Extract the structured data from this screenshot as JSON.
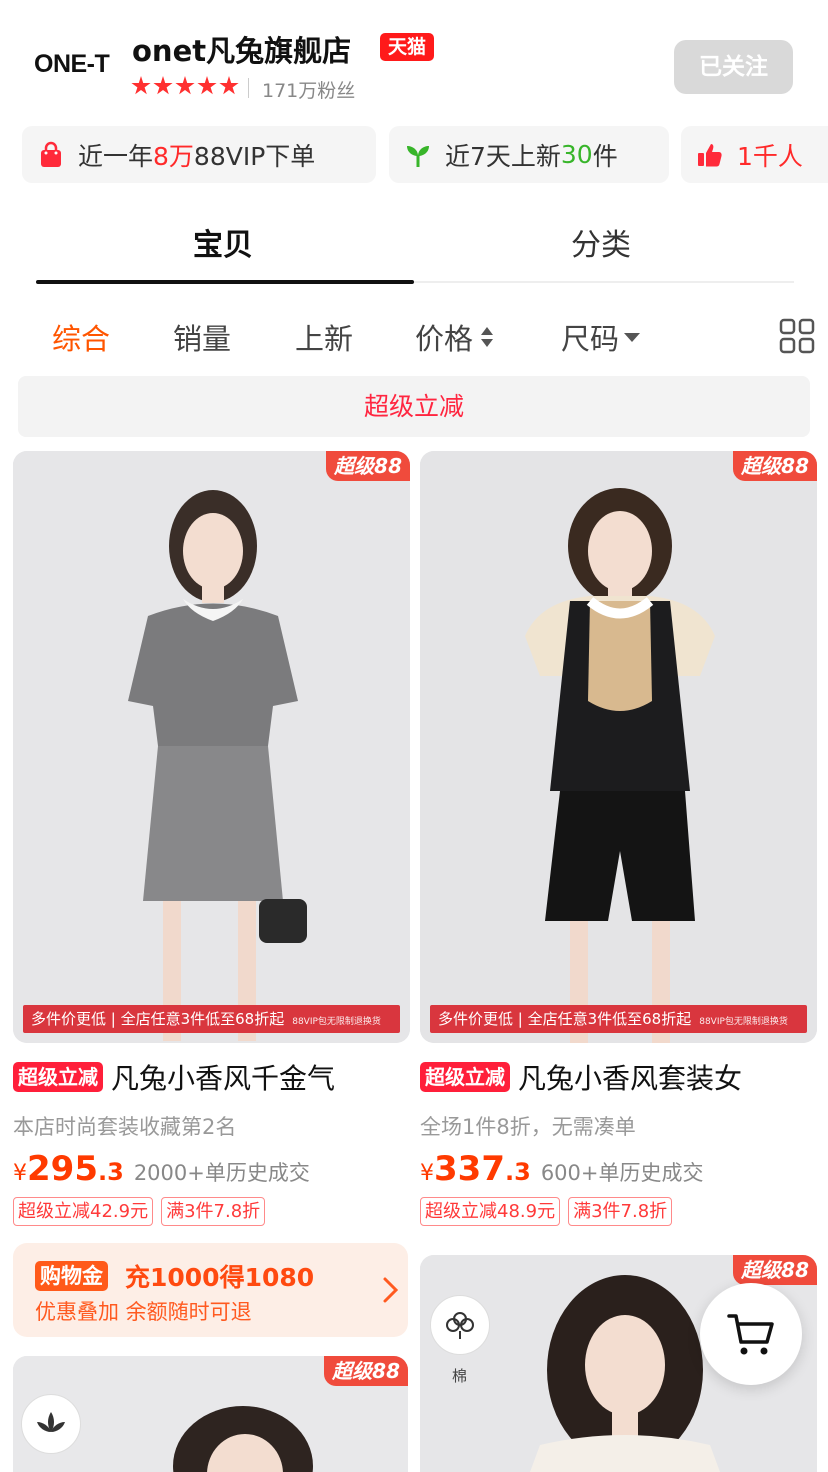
{
  "shop": {
    "logo": "ONE-T",
    "name": "onet凡兔旗舰店",
    "badge": "天猫",
    "rating_stars": 5,
    "fans": "171万粉丝",
    "follow_label": "已关注"
  },
  "chips": [
    {
      "pre": "近一年",
      "highlight": "8万",
      "post": "88VIP下单"
    },
    {
      "pre": "近7天上新",
      "highlight": "30",
      "post": "件"
    },
    {
      "pre": "",
      "highlight": "1千人",
      "post": ""
    }
  ],
  "tabs": [
    "宝贝",
    "分类"
  ],
  "sort": {
    "items": [
      "综合",
      "销量",
      "上新",
      "价格",
      "尺码"
    ],
    "active": "综合"
  },
  "banner": "超级立减",
  "products": [
    {
      "badge": "超级88",
      "strip": "多件价更低 | 全店任意3件低至68折起",
      "strip_small": "88VIP包无限制退换货",
      "tag": "超级立减",
      "title": "凡兔小香风千金气",
      "subtitle": "本店时尚套装收藏第2名",
      "currency": "¥",
      "price_int": "295",
      "price_dec": ".3",
      "sold": "2000+单历史成交",
      "promos": [
        "超级立减42.9元",
        "满3件7.8折"
      ]
    },
    {
      "badge": "超级88",
      "strip": "多件价更低 | 全店任意3件低至68折起",
      "strip_small": "88VIP包无限制退换货",
      "tag": "超级立减",
      "title": "凡兔小香风套装女",
      "subtitle": "全场1件8折，无需凑单",
      "currency": "¥",
      "price_int": "337",
      "price_dec": ".3",
      "sold": "600+单历史成交",
      "promos": [
        "超级立减48.9元",
        "满3件7.8折"
      ]
    }
  ],
  "gold": {
    "tag": "购物金",
    "main": "充1000得1080",
    "sub": "优惠叠加 余额随时可退"
  },
  "lower_cards": [
    {
      "badge": "超级88"
    },
    {
      "badge": "超级88",
      "material": "棉"
    }
  ],
  "colors": {
    "accent_red": "#ff1f3a",
    "price_orange": "#ff3a00",
    "sort_active": "#ff5500",
    "follow_bg": "#d9d9d9"
  }
}
